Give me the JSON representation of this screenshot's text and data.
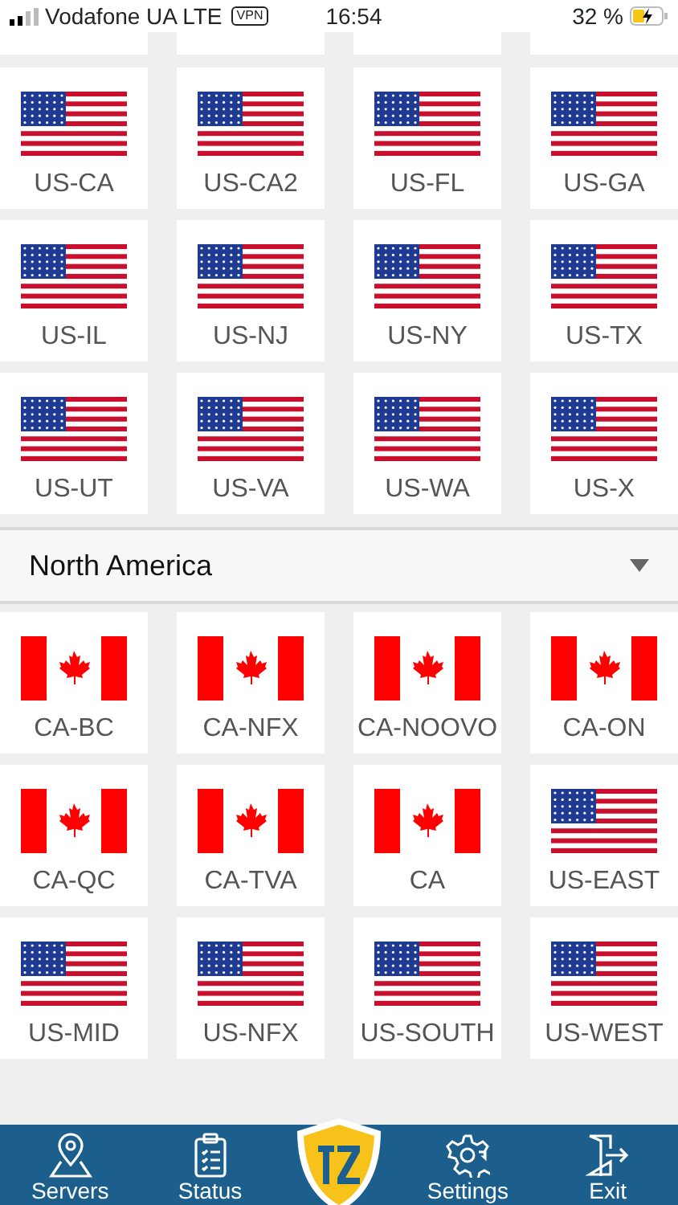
{
  "status_bar": {
    "carrier": "Vodafone UA LTE",
    "vpn": "VPN",
    "time": "16:54",
    "battery": "32 %"
  },
  "groups": [
    {
      "servers": [
        {
          "kind": "cutoff"
        },
        {
          "kind": "cutoff"
        },
        {
          "kind": "cutoff"
        },
        {
          "kind": "cutoff"
        }
      ]
    },
    {
      "servers": [
        {
          "kind": "us",
          "label": "US-CA"
        },
        {
          "kind": "us",
          "label": "US-CA2"
        },
        {
          "kind": "us",
          "label": "US-FL"
        },
        {
          "kind": "us",
          "label": "US-GA"
        },
        {
          "kind": "us",
          "label": "US-IL"
        },
        {
          "kind": "us",
          "label": "US-NJ"
        },
        {
          "kind": "us",
          "label": "US-NY"
        },
        {
          "kind": "us",
          "label": "US-TX"
        },
        {
          "kind": "us",
          "label": "US-UT"
        },
        {
          "kind": "us",
          "label": "US-VA"
        },
        {
          "kind": "us",
          "label": "US-WA"
        },
        {
          "kind": "us",
          "label": "US-X"
        }
      ]
    },
    {
      "header": "North America",
      "servers": [
        {
          "kind": "ca",
          "label": "CA-BC"
        },
        {
          "kind": "ca",
          "label": "CA-NFX"
        },
        {
          "kind": "ca",
          "label": "CA-NOOVO"
        },
        {
          "kind": "ca",
          "label": "CA-ON"
        },
        {
          "kind": "ca",
          "label": "CA-QC"
        },
        {
          "kind": "ca",
          "label": "CA-TVA"
        },
        {
          "kind": "ca",
          "label": "CA"
        },
        {
          "kind": "us",
          "label": "US-EAST"
        },
        {
          "kind": "us",
          "label": "US-MID"
        },
        {
          "kind": "us",
          "label": "US-NFX"
        },
        {
          "kind": "us",
          "label": "US-SOUTH"
        },
        {
          "kind": "us",
          "label": "US-WEST"
        }
      ]
    }
  ],
  "tab_bar": [
    {
      "kind": "servers",
      "label": "Servers"
    },
    {
      "kind": "status",
      "label": "Status"
    },
    {
      "kind": "logo"
    },
    {
      "kind": "settings",
      "label": "Settings"
    },
    {
      "kind": "exit",
      "label": "Exit"
    }
  ]
}
